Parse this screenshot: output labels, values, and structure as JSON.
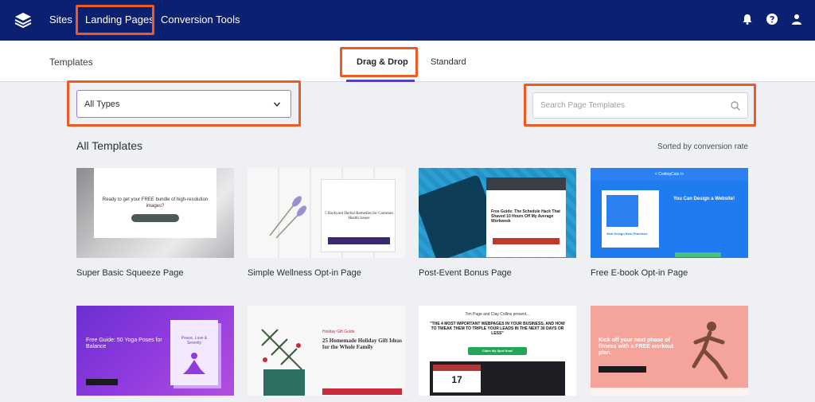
{
  "colors": {
    "nav_bg": "#0c2071",
    "accent_purple": "#5540c7",
    "highlight_orange": "#ee5a24",
    "page_bg": "#eef0f3"
  },
  "topnav": {
    "items": [
      "Sites",
      "Landing Pages",
      "Conversion Tools"
    ],
    "icons": [
      "bell-icon",
      "help-icon",
      "user-icon"
    ]
  },
  "subnav": {
    "section": "Templates",
    "tabs": [
      {
        "label": "Drag & Drop",
        "active": true
      },
      {
        "label": "Standard",
        "active": false
      }
    ]
  },
  "filters": {
    "type_select": "All Types",
    "search_placeholder": "Search Page Templates"
  },
  "templates": {
    "title": "All Templates",
    "sorted_by": "Sorted by conversion rate",
    "cards": [
      {
        "title": "Super Basic Squeeze Page",
        "thumb_heading": "Ready to get your FREE bundle of high-resolution images?"
      },
      {
        "title": "Simple Wellness Opt-in Page",
        "thumb_heading": "5 Backyard Herbal Remedies for Common Health Issues"
      },
      {
        "title": "Post-Event Bonus Page",
        "thumb_heading": "Free Guide: The Schedule Hack That Shaved 10 Hours Off My Average Workweek"
      },
      {
        "title": "Free E-book Opt-in Page",
        "thumb_heading": "You Can Design a Website!",
        "thumb_brand": "< CodingCatz />",
        "thumb_book": "Web Design Best Practices"
      },
      {
        "title": "",
        "thumb_heading": "Free Guide: 50 Yoga Poses for Balance",
        "thumb_book": "Peace, Love & Serenity"
      },
      {
        "title": "",
        "thumb_heading": "25 Homemade Holiday Gift Ideas for the Whole Family",
        "thumb_small": "Holiday Gift Guide"
      },
      {
        "title": "",
        "thumb_small": "Tim Page and Clay Collins present...",
        "thumb_heading": "\"THE 4 MOST IMPORTANT WEBPAGES IN YOUR BUSINESS, AND HOW TO TWEAK THEM TO TRIPLE YOUR LEADS IN THE NEXT 30 DAYS OR LESS\"",
        "thumb_button": "Claim My Spot Now!",
        "thumb_date": "17"
      },
      {
        "title": "",
        "thumb_heading": "Kick off your next phase of fitness with a FREE workout plan."
      }
    ]
  }
}
